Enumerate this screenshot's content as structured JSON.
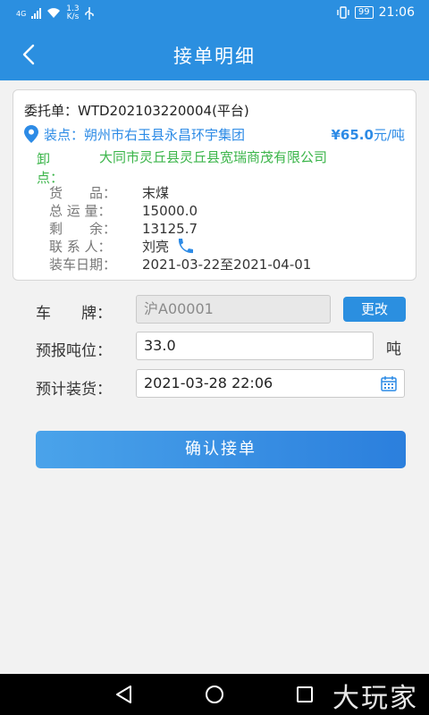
{
  "status": {
    "network": "4G",
    "speed_top": "1.3",
    "speed_bottom": "K/s",
    "battery": "99",
    "time": "21:06"
  },
  "header": {
    "title": "接单明细"
  },
  "order": {
    "title": "委托单：WTD202103220004(平台)",
    "load_label": "装点：",
    "load_value": "朔州市右玉县永昌环宇集团",
    "price": "¥65.0",
    "price_unit": "元/吨",
    "unload_label": "卸点：",
    "unload_value": "大同市灵丘县灵丘县宽瑞商茂有限公司",
    "fields": [
      {
        "key": "货　　品：",
        "value": "末煤"
      },
      {
        "key": "总 运 量：",
        "value": "15000.0"
      },
      {
        "key": "剩　　余：",
        "value": "13125.7"
      },
      {
        "key": "联 系 人：",
        "value": "刘亮"
      },
      {
        "key": "装车日期：",
        "value": "2021-03-22至2021-04-01"
      }
    ]
  },
  "form": {
    "plate_label": "车　　牌：",
    "plate_value": "沪A00001",
    "change_label": "更改",
    "tonnage_label": "预报吨位：",
    "tonnage_value": "33.0",
    "tonnage_unit": "吨",
    "loadtime_label": "预计装货：",
    "loadtime_value": "2021-03-28 22:06",
    "confirm_label": "确认接单"
  },
  "watermark": "大玩家",
  "colors": {
    "primary": "#2b8fe0",
    "green": "#3bb54a"
  }
}
